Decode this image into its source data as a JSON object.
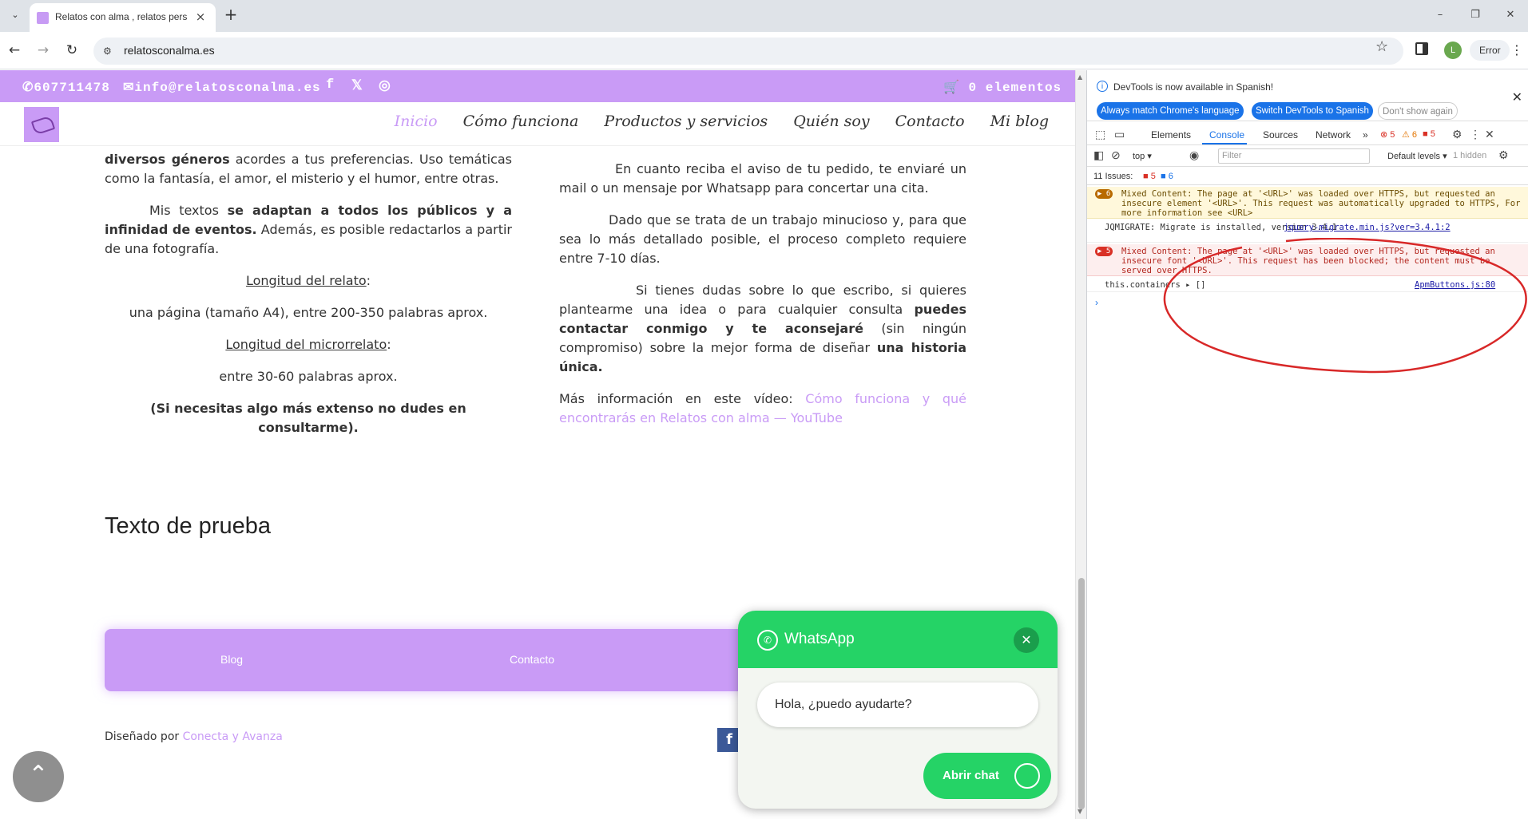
{
  "browser": {
    "tab_title": "Relatos con alma , relatos personalizados",
    "url": "relatosconalma.es",
    "profile_initial": "L",
    "error_label": "Error"
  },
  "topbar": {
    "phone": "607711478",
    "email": "info@relatosconalma.es",
    "cart": "0 elementos"
  },
  "nav": {
    "items": [
      "Inicio",
      "Cómo funciona",
      "Productos y servicios",
      "Quién soy",
      "Contacto",
      "Mi blog"
    ]
  },
  "left_col": {
    "p1_bold": "diversos géneros",
    "p1_text": " acordes a tus preferencias. Uso temáticas como la fantasía, el amor, el misterio y el humor, entre otras.",
    "p2_pre": "Mis textos ",
    "p2_bold": "se adaptan a todos los públicos y a infinidad de eventos.",
    "p2_text": " Además, es posible redactarlos a partir de una fotografía.",
    "length_label": "Longitud del relato",
    "length_value": "una página (tamaño A4), entre 200-350 palabras aprox.",
    "micro_label": "Longitud del microrrelato",
    "micro_value": "entre 30-60 palabras aprox.",
    "consult_note": "(Si necesitas algo más extenso no dudes en consultarme)."
  },
  "right_col": {
    "p1": "En cuanto reciba el aviso de tu pedido, te enviaré un mail o un mensaje por Whatsapp para concertar una cita.",
    "p2": "Dado que se trata de un trabajo minucioso y, para que sea lo más detallado posible, el proceso completo requiere entre 7-10 días.",
    "p3_pre": "Si tienes dudas sobre lo que escribo, si quieres plantearme una idea o para cualquier consulta ",
    "p3_bold1": "puedes contactar conmigo y te aconsejaré",
    "p3_mid": " (sin ningún compromiso) sobre la mejor forma de diseñar ",
    "p3_bold2": "una historia única.",
    "p4_pre": "Más información en este vídeo: ",
    "p4_link": "Cómo funciona y qué encontrarás en Relatos con alma — YouTube"
  },
  "section_title": "Texto de prueba",
  "footer": {
    "menu": [
      "Blog",
      "Contacto"
    ],
    "credit_pre": "Diseñado por ",
    "credit_link": "Conecta y Avanza"
  },
  "whatsapp": {
    "title": "WhatsApp",
    "greeting": "Hola, ¿puedo ayudarte?",
    "cta": "Abrir chat"
  },
  "devtools": {
    "notice": "DevTools is now available in Spanish!",
    "btn_match": "Always match Chrome's language",
    "btn_switch": "Switch DevTools to Spanish",
    "btn_dismiss": "Don't show again",
    "tabs": [
      "Elements",
      "Console",
      "Sources",
      "Network"
    ],
    "err_count": "5",
    "warn_count": "6",
    "issue_count": "5",
    "context": "top",
    "filter_placeholder": "Filter",
    "levels": "Default levels",
    "hidden": "1 hidden",
    "issues_label": "11 Issues:",
    "issues_err": "5",
    "issues_info": "6",
    "logs": [
      {
        "count": "6",
        "text": "Mixed Content: The page at '<URL>' was loaded over HTTPS, but requested an insecure element '<URL>'. This request was automatically upgraded to HTTPS, For more information see <URL>"
      },
      {
        "text": "JQMIGRATE: Migrate is installed, version 3.4.1",
        "src": "jquery-migrate.min.js?ver=3.4.1:2"
      },
      {
        "count": "5",
        "text": "Mixed Content: The page at '<URL>' was loaded over HTTPS, but requested an insecure font '<URL>'. This request has been blocked; the content must be served over HTTPS."
      },
      {
        "text": "this.containers  ▸ []",
        "src": "ApmButtons.js:80"
      }
    ]
  }
}
